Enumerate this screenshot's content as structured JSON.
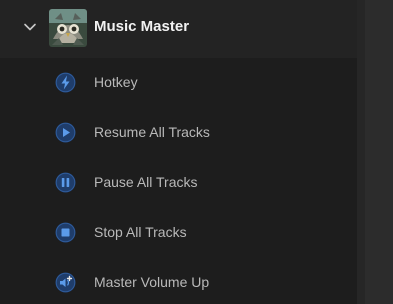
{
  "plugin": {
    "title": "Music Master",
    "icon": "owl-logo-icon",
    "expanded": true
  },
  "actions": [
    {
      "label": "Hotkey",
      "icon": "lightning-icon"
    },
    {
      "label": "Resume All Tracks",
      "icon": "play-icon"
    },
    {
      "label": "Pause All Tracks",
      "icon": "pause-icon"
    },
    {
      "label": "Stop All Tracks",
      "icon": "stop-icon"
    },
    {
      "label": "Master Volume Up",
      "icon": "volume-up-icon"
    }
  ],
  "colors": {
    "background": "#1f1f1f",
    "icon_fill": "#1f3d6b",
    "icon_glyph": "#5b9bea",
    "label_text": "#b9b9b9",
    "title_text": "#f2f2f2"
  }
}
